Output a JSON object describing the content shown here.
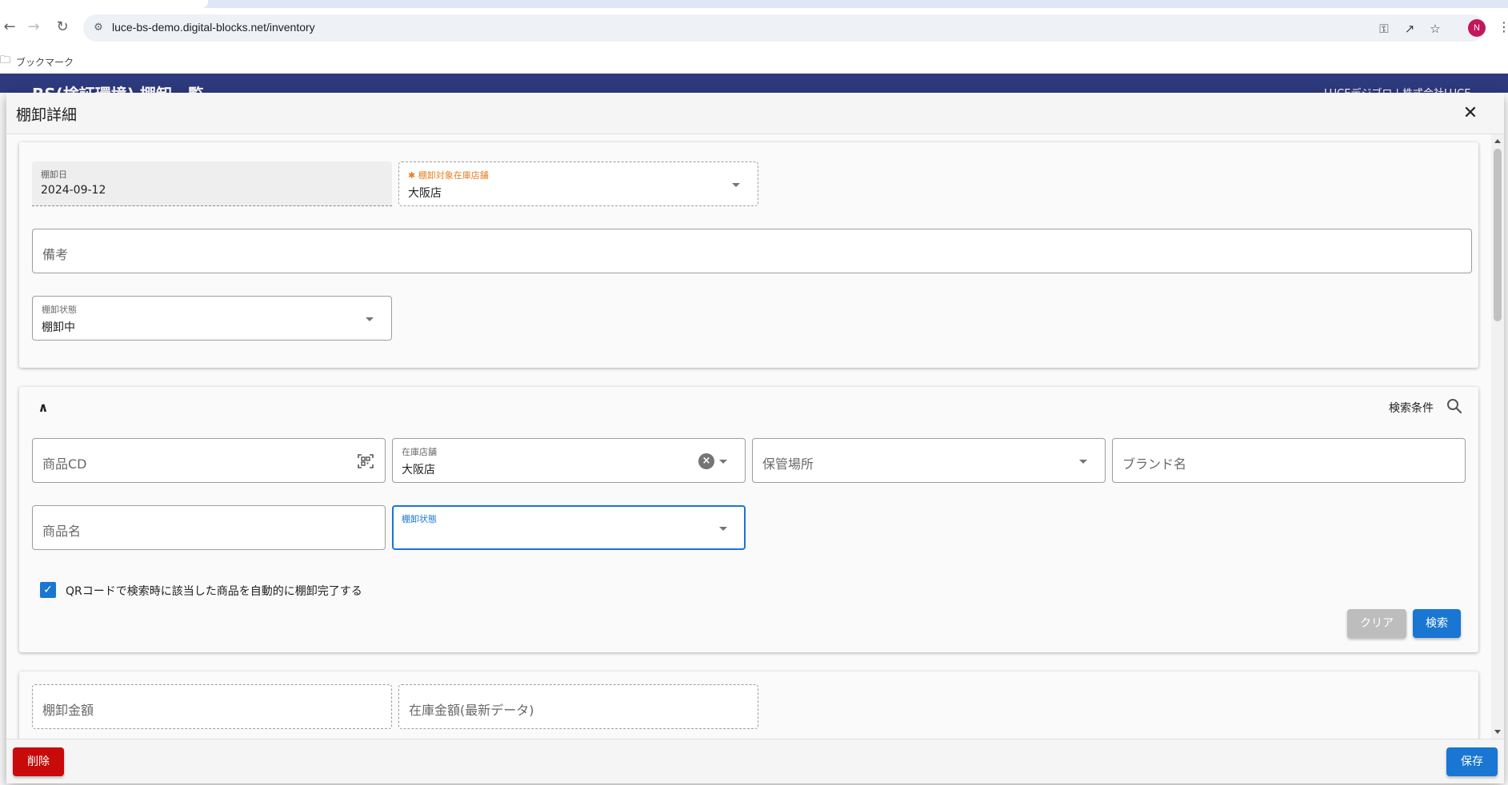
{
  "browser": {
    "url": "luce-bs-demo.digital-blocks.net/inventory",
    "profile_initial": "N",
    "bookmarks_label": "ブックマーク"
  },
  "app": {
    "title": "BS(検証環境) 棚卸一覧",
    "user": "LUCEデジブロ | 株式会社LUCE"
  },
  "dialog": {
    "title": "棚卸詳細",
    "close_icon": "close-icon"
  },
  "basic_info": {
    "inventory_date": {
      "label": "棚卸日",
      "value": "2024-09-12"
    },
    "target_store": {
      "label": "棚卸対象在庫店舗",
      "value": "大阪店",
      "required": true
    },
    "remarks": {
      "placeholder": "備考"
    },
    "inventory_status": {
      "label": "棚卸状態",
      "value": "棚卸中"
    }
  },
  "search_panel": {
    "title": "検索条件",
    "product_cd": {
      "placeholder": "商品CD"
    },
    "stock_store": {
      "label": "在庫店舗",
      "value": "大阪店"
    },
    "storage_location": {
      "placeholder": "保管場所"
    },
    "brand_name": {
      "placeholder": "ブランド名"
    },
    "product_name": {
      "placeholder": "商品名"
    },
    "inventory_status": {
      "label": "棚卸状態",
      "value": ""
    },
    "auto_complete_checkbox": {
      "label": "QRコードで検索時に該当した商品を自動的に棚卸完了する",
      "checked": true
    },
    "clear_label": "クリア",
    "search_label": "検索"
  },
  "amounts": {
    "inventory_amount": {
      "placeholder": "棚卸金額"
    },
    "stock_amount": {
      "placeholder": "在庫金額(最新データ)"
    }
  },
  "footer": {
    "delete_label": "削除",
    "save_label": "保存"
  },
  "colors": {
    "primary": "#1976d2",
    "danger": "#c80a0a",
    "required": "#e67e22",
    "app_header": "#2d3a7d"
  }
}
